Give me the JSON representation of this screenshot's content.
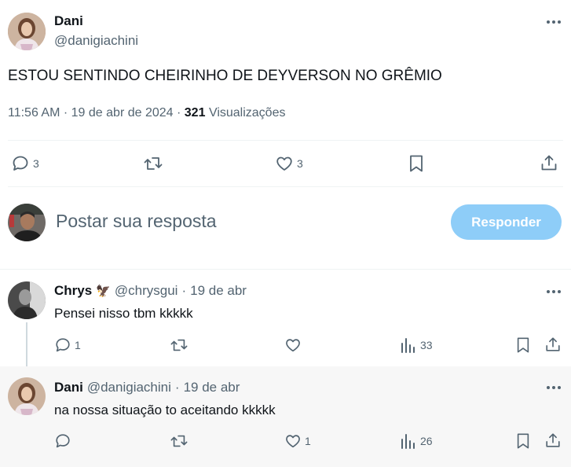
{
  "tweet": {
    "author_name": "Dani",
    "author_handle": "@danigiachini",
    "text": "ESTOU SENTINDO CHEIRINHO DE DEYVERSON NO GRÊMIO",
    "time": "11:56 AM",
    "dot1": "·",
    "date": "19 de abr de 2024",
    "dot2": "·",
    "views_count": "321",
    "views_label": "Visualizações",
    "replies": "3",
    "likes": "3"
  },
  "composer": {
    "placeholder": "Postar sua resposta",
    "button_label": "Responder"
  },
  "replies": [
    {
      "author_name": "Chrys",
      "emoji": "🦅",
      "author_handle": "@chrysgui",
      "sep": "·",
      "date": "19 de abr",
      "text": "Pensei nisso tbm kkkkk",
      "replies": "1",
      "likes": "",
      "views": "33"
    },
    {
      "author_name": "Dani",
      "author_handle": "@danigiachini",
      "sep": "·",
      "date": "19 de abr",
      "text": "na nossa situação to aceitando kkkkk",
      "replies": "",
      "likes": "1",
      "views": "26"
    }
  ],
  "colors": {
    "accent": "#1d9bf0",
    "button_disabled": "#8ecdf8",
    "text_primary": "#0f1419",
    "text_secondary": "#536471",
    "divider": "#eff3f4",
    "highlight_bg": "#f7f7f7"
  }
}
